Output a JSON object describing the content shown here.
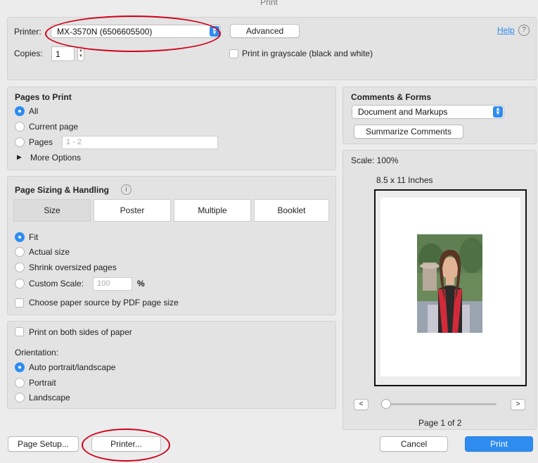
{
  "window": {
    "title": "Print"
  },
  "printer": {
    "label": "Printer:",
    "selected": "MX-3570N (6506605500)",
    "advanced_label": "Advanced",
    "help_label": "Help",
    "help_icon": "?",
    "copies_label": "Copies:",
    "copies_value": "1",
    "grayscale_label": "Print in grayscale (black and white)"
  },
  "pages_to_print": {
    "heading": "Pages to Print",
    "options": [
      "All",
      "Current page",
      "Pages"
    ],
    "pages_placeholder": "1 - 2",
    "more_options": "More Options"
  },
  "sizing": {
    "heading": "Page Sizing & Handling",
    "info_icon": "i",
    "tabs": [
      "Size",
      "Poster",
      "Multiple",
      "Booklet"
    ],
    "options": [
      "Fit",
      "Actual size",
      "Shrink oversized pages",
      "Custom Scale:"
    ],
    "custom_scale_placeholder": "100",
    "percent": "%",
    "paper_source_label": "Choose paper source by PDF page size"
  },
  "duplex": {
    "both_sides_label": "Print on both sides of paper",
    "orientation_label": "Orientation:",
    "options": [
      "Auto portrait/landscape",
      "Portrait",
      "Landscape"
    ]
  },
  "comments_forms": {
    "heading": "Comments & Forms",
    "selected": "Document and Markups",
    "summarize_label": "Summarize Comments"
  },
  "preview": {
    "scale": "Scale: 100%",
    "paper_size": "8.5 x 11 Inches",
    "page_indicator": "Page 1 of 2",
    "prev_label": "<",
    "next_label": ">"
  },
  "footer": {
    "page_setup_label": "Page Setup...",
    "printer_label": "Printer...",
    "cancel_label": "Cancel",
    "print_label": "Print"
  },
  "colors": {
    "accent": "#2e8cf0",
    "annotation": "#d0021b"
  }
}
